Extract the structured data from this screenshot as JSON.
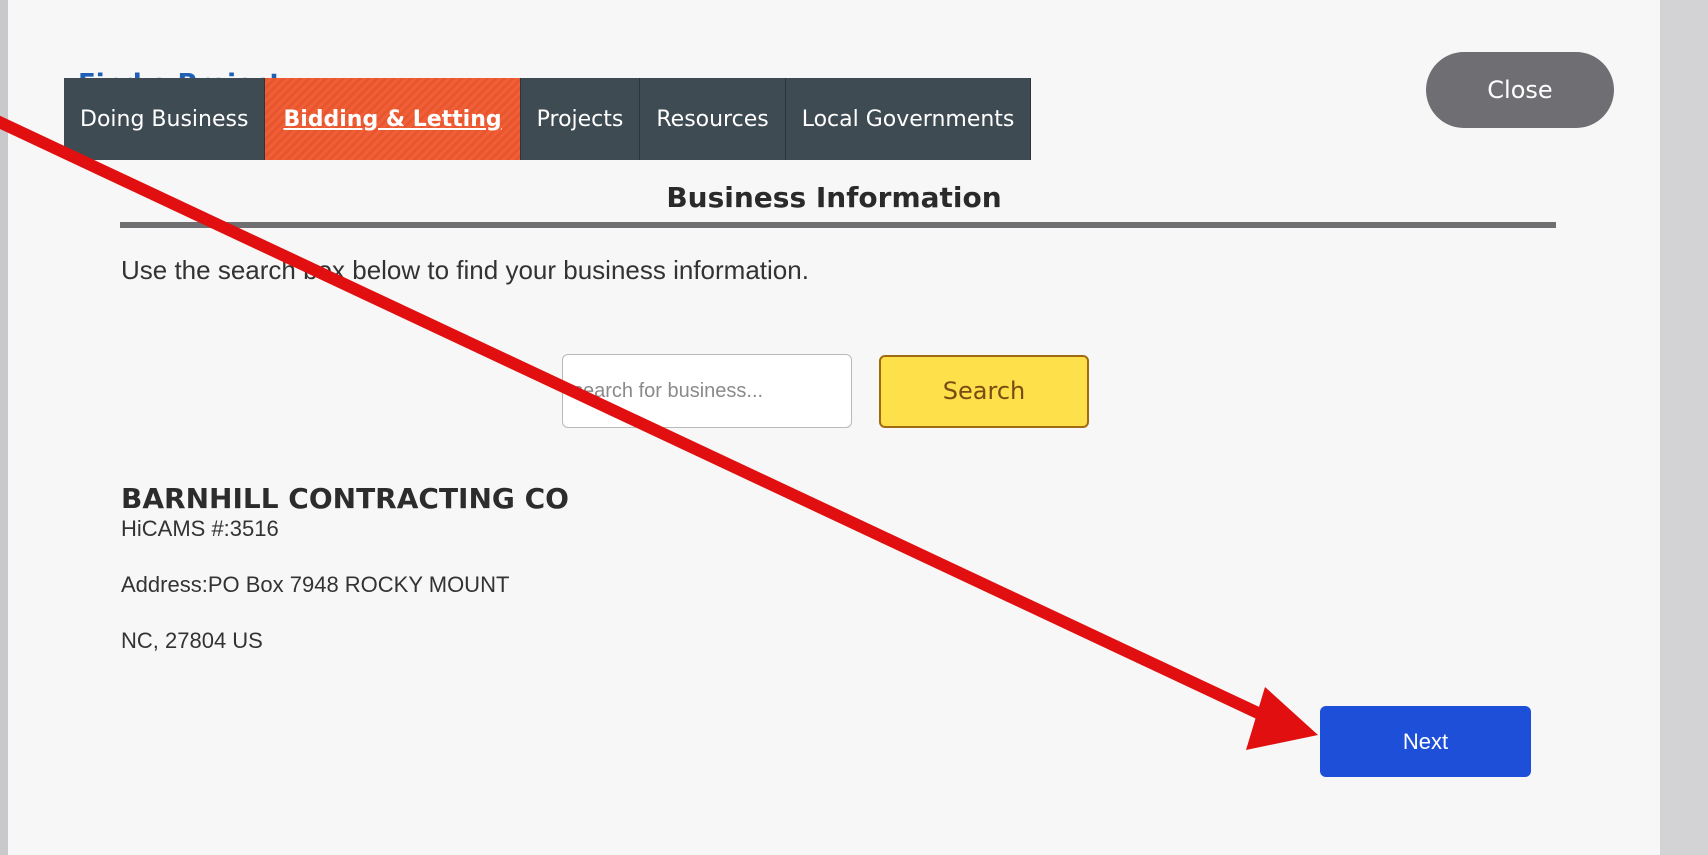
{
  "header": {
    "nav_items": [
      "Doing Business",
      "Bidding & Letting",
      "Projects",
      "Resources",
      "Local Governments"
    ],
    "active_tab": "Bidding & Letting"
  },
  "modal": {
    "close_label": "Close",
    "title": "Business Information",
    "instructions": "Use the search box below to find your business information.",
    "search": {
      "placeholder": "search for business...",
      "button_label": "Search"
    },
    "result": {
      "name": "BARNHILL CONTRACTING CO",
      "hicams": "HiCAMS #:3516",
      "address": "Address:PO Box 7948 ROCKY MOUNT",
      "location": "NC, 27804 US"
    },
    "next_label": "Next"
  },
  "colors": {
    "nav_bg": "#3f4b52",
    "nav_active": "#ef5b34",
    "search_button": "#fde04a",
    "next_button": "#1d4fd8",
    "annotation_arrow": "#e10f0f"
  }
}
